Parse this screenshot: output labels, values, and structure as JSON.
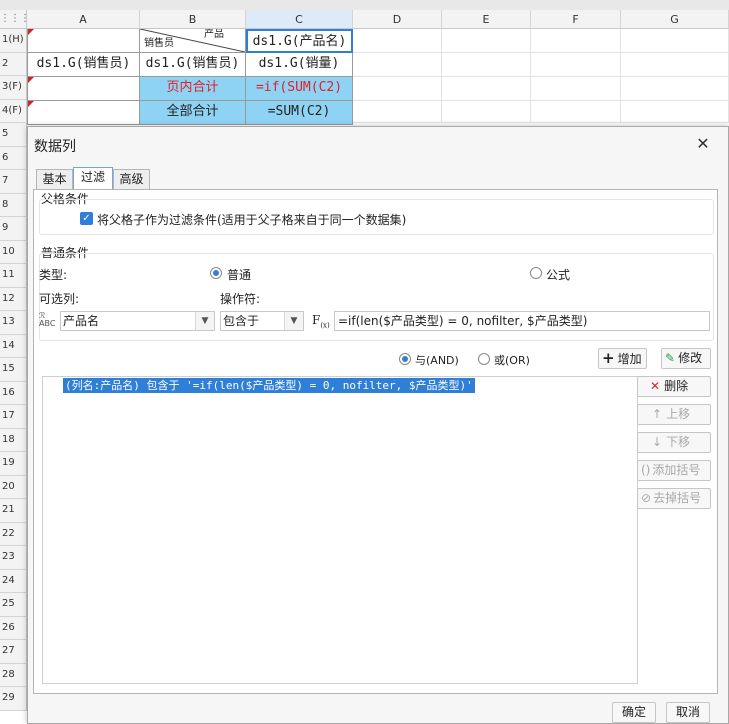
{
  "sheet": {
    "columns": [
      "A",
      "B",
      "C",
      "D",
      "E",
      "F",
      "G"
    ],
    "rows": [
      "1(H)",
      "2",
      "3(F)",
      "4(F)",
      "5",
      "6",
      "7",
      "8",
      "9",
      "10",
      "11",
      "12",
      "13",
      "14",
      "15",
      "16",
      "17",
      "18",
      "19",
      "20",
      "21",
      "22",
      "23",
      "24",
      "25",
      "26",
      "27",
      "28",
      "29"
    ],
    "b1_top": "产品",
    "b1_bottom": "销售员",
    "c1": "ds1.G(产品名)",
    "a2": "ds1.G(销售员)",
    "b2": "ds1.G(销售员)",
    "c2": "ds1.G(销量)",
    "b3": "页内合计",
    "c3": "=if(SUM(C2)",
    "b4": "全部合计",
    "c4": "=SUM(C2)",
    "colors": {
      "highlight": "#8fd3f4",
      "red_text": "#e0202a"
    }
  },
  "dialog": {
    "title": "数据列",
    "tabs": [
      "基本",
      "过滤",
      "高级"
    ],
    "active_tab": "过滤",
    "parent_section": {
      "title": "父格条件",
      "checkbox_label": "将父格子作为过滤条件(适用于父子格来自于同一个数据集)",
      "checked": true
    },
    "common_section": {
      "title": "普通条件",
      "type_label": "类型:",
      "radio_normal": "普通",
      "radio_formula": "公式",
      "selected_type": "普通",
      "col_label": "可选列:",
      "op_label": "操作符:",
      "col_value": "产品名",
      "op_value": "包含于",
      "formula_value": "=if(len($产品类型) = 0, nofilter, $产品类型)",
      "and_label": "与(AND)",
      "or_label": "或(OR)",
      "selected_logic": "与(AND)"
    },
    "condition_list": [
      "(列名:产品名) 包含于 '=if(len($产品类型) = 0, nofilter, $产品类型)'"
    ],
    "buttons": {
      "add": "增加",
      "modify": "修改",
      "delete": "删除",
      "up": "上移",
      "down": "下移",
      "add_bracket": "添加括号",
      "remove_bracket": "去掉括号",
      "ok": "确定",
      "cancel": "取消"
    }
  }
}
